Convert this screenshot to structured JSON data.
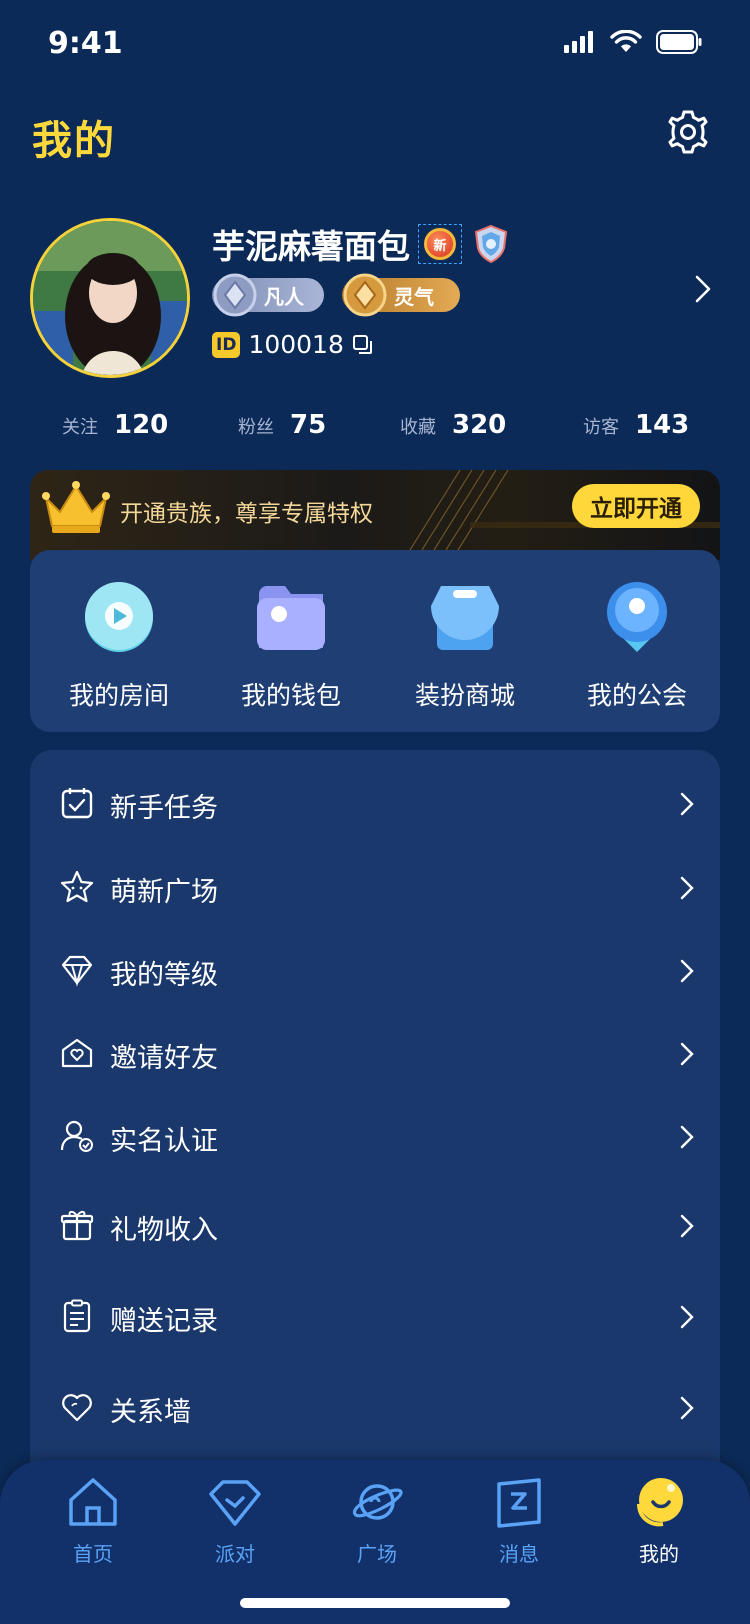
{
  "status_bar": {
    "time": "9:41"
  },
  "header": {
    "title": "我的"
  },
  "profile": {
    "nickname": "芋泥麻薯面包",
    "badge_new": "新",
    "tags": [
      "凡人",
      "灵气"
    ],
    "id_label": "ID",
    "id_value": "100018"
  },
  "stats": [
    {
      "label": "关注",
      "value": "120"
    },
    {
      "label": "粉丝",
      "value": "75"
    },
    {
      "label": "收藏",
      "value": "320"
    },
    {
      "label": "访客",
      "value": "143"
    }
  ],
  "vip": {
    "text": "开通贵族，尊享专属特权",
    "button": "立即开通"
  },
  "quick_actions": [
    {
      "label": "我的房间",
      "icon": "play-icon"
    },
    {
      "label": "我的钱包",
      "icon": "wallet-icon"
    },
    {
      "label": "装扮商城",
      "icon": "store-icon"
    },
    {
      "label": "我的公会",
      "icon": "guild-icon"
    }
  ],
  "menu": [
    {
      "label": "新手任务",
      "icon": "calendar-check-icon"
    },
    {
      "label": "萌新广场",
      "icon": "star-icon"
    },
    {
      "label": "我的等级",
      "icon": "diamond-icon"
    },
    {
      "label": "邀请好友",
      "icon": "invite-icon"
    },
    {
      "label": "实名认证",
      "icon": "user-verify-icon"
    },
    {
      "label": "礼物收入",
      "icon": "gift-icon"
    },
    {
      "label": "赠送记录",
      "icon": "record-icon"
    },
    {
      "label": "关系墙",
      "icon": "heart-icon"
    }
  ],
  "tabs": [
    {
      "label": "首页",
      "icon": "home-icon"
    },
    {
      "label": "派对",
      "icon": "party-icon"
    },
    {
      "label": "广场",
      "icon": "planet-icon"
    },
    {
      "label": "消息",
      "icon": "message-icon"
    },
    {
      "label": "我的",
      "icon": "profile-icon",
      "active": true
    }
  ],
  "colors": {
    "accent": "#ffd93b",
    "background": "#0c2a57",
    "tab_inactive": "#5aa2f5"
  }
}
